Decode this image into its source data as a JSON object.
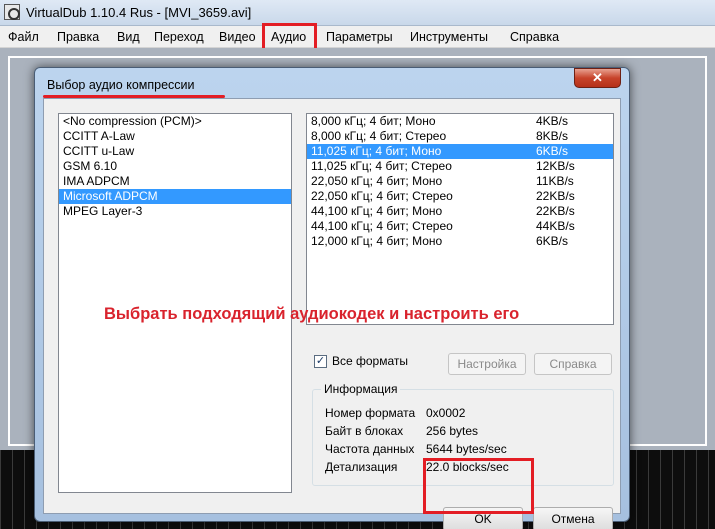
{
  "app": {
    "title": "VirtualDub 1.10.4 Rus - [MVI_3659.avi]"
  },
  "menu": [
    "Файл",
    "Правка",
    "Вид",
    "Переход",
    "Видео",
    "Аудио",
    "Параметры",
    "Инструменты",
    "Справка"
  ],
  "dialog": {
    "title": "Выбор аудио компрессии",
    "close_label": "✕",
    "formats": [
      {
        "label": "<No compression (PCM)>",
        "selected": false
      },
      {
        "label": "CCITT A-Law",
        "selected": false
      },
      {
        "label": "CCITT u-Law",
        "selected": false
      },
      {
        "label": "GSM 6.10",
        "selected": false
      },
      {
        "label": "IMA ADPCM",
        "selected": false
      },
      {
        "label": "Microsoft ADPCM",
        "selected": true
      },
      {
        "label": "MPEG Layer-3",
        "selected": false
      }
    ],
    "attributes": [
      {
        "label": "8,000 кГц; 4 бит; Моно",
        "rate": "4KB/s",
        "selected": false
      },
      {
        "label": "8,000 кГц; 4 бит; Стерео",
        "rate": "8KB/s",
        "selected": false
      },
      {
        "label": "11,025 кГц; 4 бит; Моно",
        "rate": "6KB/s",
        "selected": true
      },
      {
        "label": "11,025 кГц; 4 бит; Стерео",
        "rate": "12KB/s",
        "selected": false
      },
      {
        "label": "22,050 кГц; 4 бит; Моно",
        "rate": "11KB/s",
        "selected": false
      },
      {
        "label": "22,050 кГц; 4 бит; Стерео",
        "rate": "22KB/s",
        "selected": false
      },
      {
        "label": "44,100 кГц; 4 бит; Моно",
        "rate": "22KB/s",
        "selected": false
      },
      {
        "label": "44,100 кГц; 4 бит; Стерео",
        "rate": "44KB/s",
        "selected": false
      },
      {
        "label": "12,000 кГц; 4 бит; Моно",
        "rate": "6KB/s",
        "selected": false
      }
    ],
    "annotation": "Выбрать подходящий аудиокодек и настроить его",
    "all_formats": {
      "label": "Все форматы",
      "checked": true
    },
    "buttons": {
      "configure": "Настройка",
      "help": "Справка",
      "ok": "OK",
      "cancel": "Отмена"
    },
    "info": {
      "title": "Информация",
      "rows": [
        {
          "label": "Номер формата",
          "value": "0x0002"
        },
        {
          "label": "Байт в блоках",
          "value": "256 bytes"
        },
        {
          "label": "Частота данных",
          "value": "5644 bytes/sec"
        },
        {
          "label": "Детализация",
          "value": "22.0 blocks/sec"
        }
      ]
    }
  },
  "colors": {
    "highlight": "#e31d24",
    "selection": "#3399ff",
    "annotation_text": "#d9232d"
  }
}
